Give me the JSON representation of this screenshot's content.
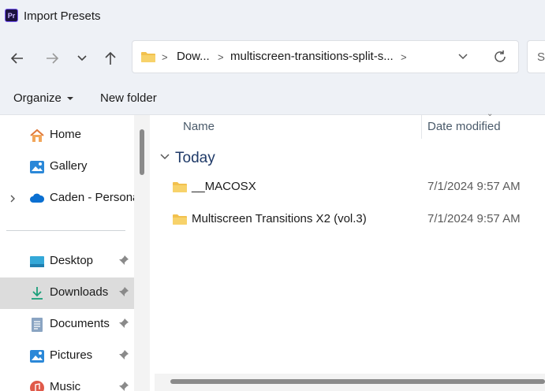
{
  "window": {
    "title": "Import Presets",
    "app_badge": "Pr"
  },
  "nav": {
    "back_icon": "arrow-left-icon",
    "forward_icon": "arrow-right-icon",
    "recent_icon": "chevron-down-icon",
    "up_icon": "arrow-up-icon"
  },
  "address": {
    "crumbs": [
      "Dow...",
      "multiscreen-transitions-split-s..."
    ],
    "separator": ">"
  },
  "search": {
    "placeholder": "S"
  },
  "toolbar": {
    "organize_label": "Organize",
    "new_folder_label": "New folder"
  },
  "sidebar": {
    "items": [
      {
        "label": "Home",
        "icon": "home-icon"
      },
      {
        "label": "Gallery",
        "icon": "gallery-icon"
      },
      {
        "label": "Caden - Persona",
        "icon": "onedrive-icon"
      },
      {
        "label": "Desktop",
        "icon": "desktop-icon",
        "pinned": true
      },
      {
        "label": "Downloads",
        "icon": "download-icon",
        "pinned": true,
        "selected": true
      },
      {
        "label": "Documents",
        "icon": "documents-icon",
        "pinned": true
      },
      {
        "label": "Pictures",
        "icon": "pictures-icon",
        "pinned": true
      },
      {
        "label": "Music",
        "icon": "music-icon",
        "pinned": true
      }
    ]
  },
  "columns": {
    "name": "Name",
    "date": "Date modified"
  },
  "group": {
    "label": "Today"
  },
  "files": [
    {
      "name": "__MACOSX",
      "date": "7/1/2024 9:57 AM",
      "icon": "folder-icon"
    },
    {
      "name": "Multiscreen Transitions X2 (vol.3)",
      "date": "7/1/2024 9:57 AM",
      "icon": "folder-icon"
    }
  ],
  "colors": {
    "folder": "#f2c14e",
    "selected_row": "#dcdcdc",
    "chrome": "#eef1f6",
    "group_heading": "#1f3a68"
  }
}
